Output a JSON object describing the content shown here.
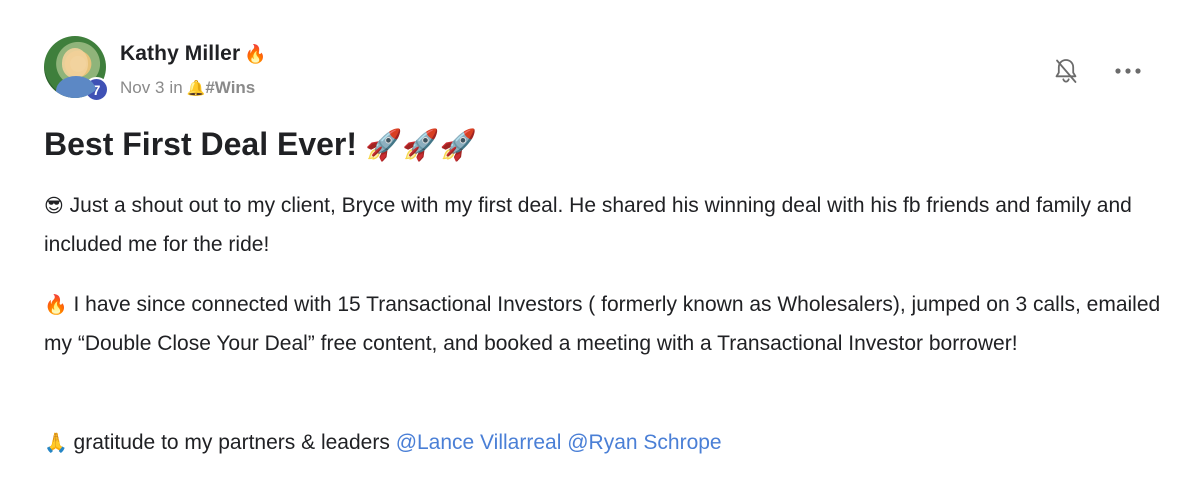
{
  "author": {
    "name": "Kathy Miller",
    "name_emoji": "🔥",
    "level": "7"
  },
  "meta": {
    "date": "Nov 3",
    "in_label": "in",
    "channel_emoji": "🔔",
    "channel": "#Wins"
  },
  "post": {
    "title": "Best First Deal Ever!",
    "title_emoji": "🚀🚀🚀",
    "p1_emoji": "😎",
    "p1_text": "Just a shout out to my client, Bryce with my first deal. He shared his winning deal with his fb friends and family and included me for the ride!",
    "p2_emoji": "🔥",
    "p2_text": "I have since connected with 15 Transactional Investors ( formerly known as Wholesalers), jumped on 3 calls, emailed my “Double Close Your Deal” free content, and booked a meeting with a Transactional Investor borrower!",
    "p3_emoji": "🙏",
    "p3_text": "gratitude to my partners & leaders",
    "mentions": [
      "@Lance Villarreal",
      "@Ryan Schrope"
    ]
  },
  "icons": {
    "notify": "bell-off-icon",
    "more": "more-horizontal-icon"
  },
  "colors": {
    "text": "#202124",
    "muted": "#8a8a8a",
    "mention": "#4a7fd6",
    "level_badge": "#3f51b5"
  }
}
